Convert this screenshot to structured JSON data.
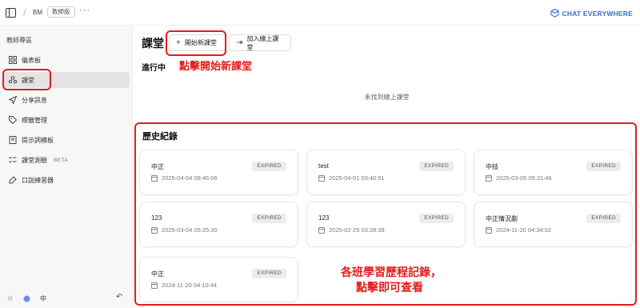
{
  "topbar": {
    "workspace": "BM",
    "badge": "教師版",
    "more": "···",
    "brand": "CHAT EVERYWHERE"
  },
  "sidebar": {
    "heading": "教師專區",
    "items": [
      {
        "label": "儀表板",
        "icon": "grid-icon"
      },
      {
        "label": "課堂",
        "icon": "people-icon"
      },
      {
        "label": "分享訊息",
        "icon": "send-icon"
      },
      {
        "label": "標籤管理",
        "icon": "tag-icon"
      },
      {
        "label": "提示詞模板",
        "icon": "book-icon"
      },
      {
        "label": "課堂測驗",
        "icon": "checklist-icon",
        "badge": "BETA"
      },
      {
        "label": "口說練習器",
        "icon": "mic-icon"
      }
    ],
    "footer": {
      "lang": "中"
    }
  },
  "main": {
    "title": "課堂",
    "start_button": "開始新課堂",
    "join_button": "加入線上課堂",
    "in_progress": "進行中",
    "empty_message": "未找到線上課堂",
    "history_title": "歷史紀錄",
    "cards": [
      {
        "name": "中正",
        "status": "EXPIRED",
        "time": "2025-04-04 09:46:06"
      },
      {
        "name": "test",
        "status": "EXPIRED",
        "time": "2025-04-01 03:40:51"
      },
      {
        "name": "中技",
        "status": "EXPIRED",
        "time": "2025-03-05 05:31:46"
      },
      {
        "name": "123",
        "status": "EXPIRED",
        "time": "2025-03-04 05:25:30"
      },
      {
        "name": "123",
        "status": "EXPIRED",
        "time": "2025-02-25 03:28:38"
      },
      {
        "name": "中正情況劇",
        "status": "EXPIRED",
        "time": "2024-11-20 04:34:02"
      },
      {
        "name": "中正",
        "status": "EXPIRED",
        "time": "2024-11-20 04:10:44"
      }
    ]
  },
  "annotations": {
    "start_hint": "點擊開始新課堂",
    "history_hint_line1": "各班學習歷程記錄，",
    "history_hint_line2": "點擊即可查看"
  },
  "colors": {
    "brand": "#2f6fda",
    "annotation": "#e11d1d",
    "sidebar_bg": "#f7f7f7",
    "active_item_bg": "#e3e3e3"
  }
}
